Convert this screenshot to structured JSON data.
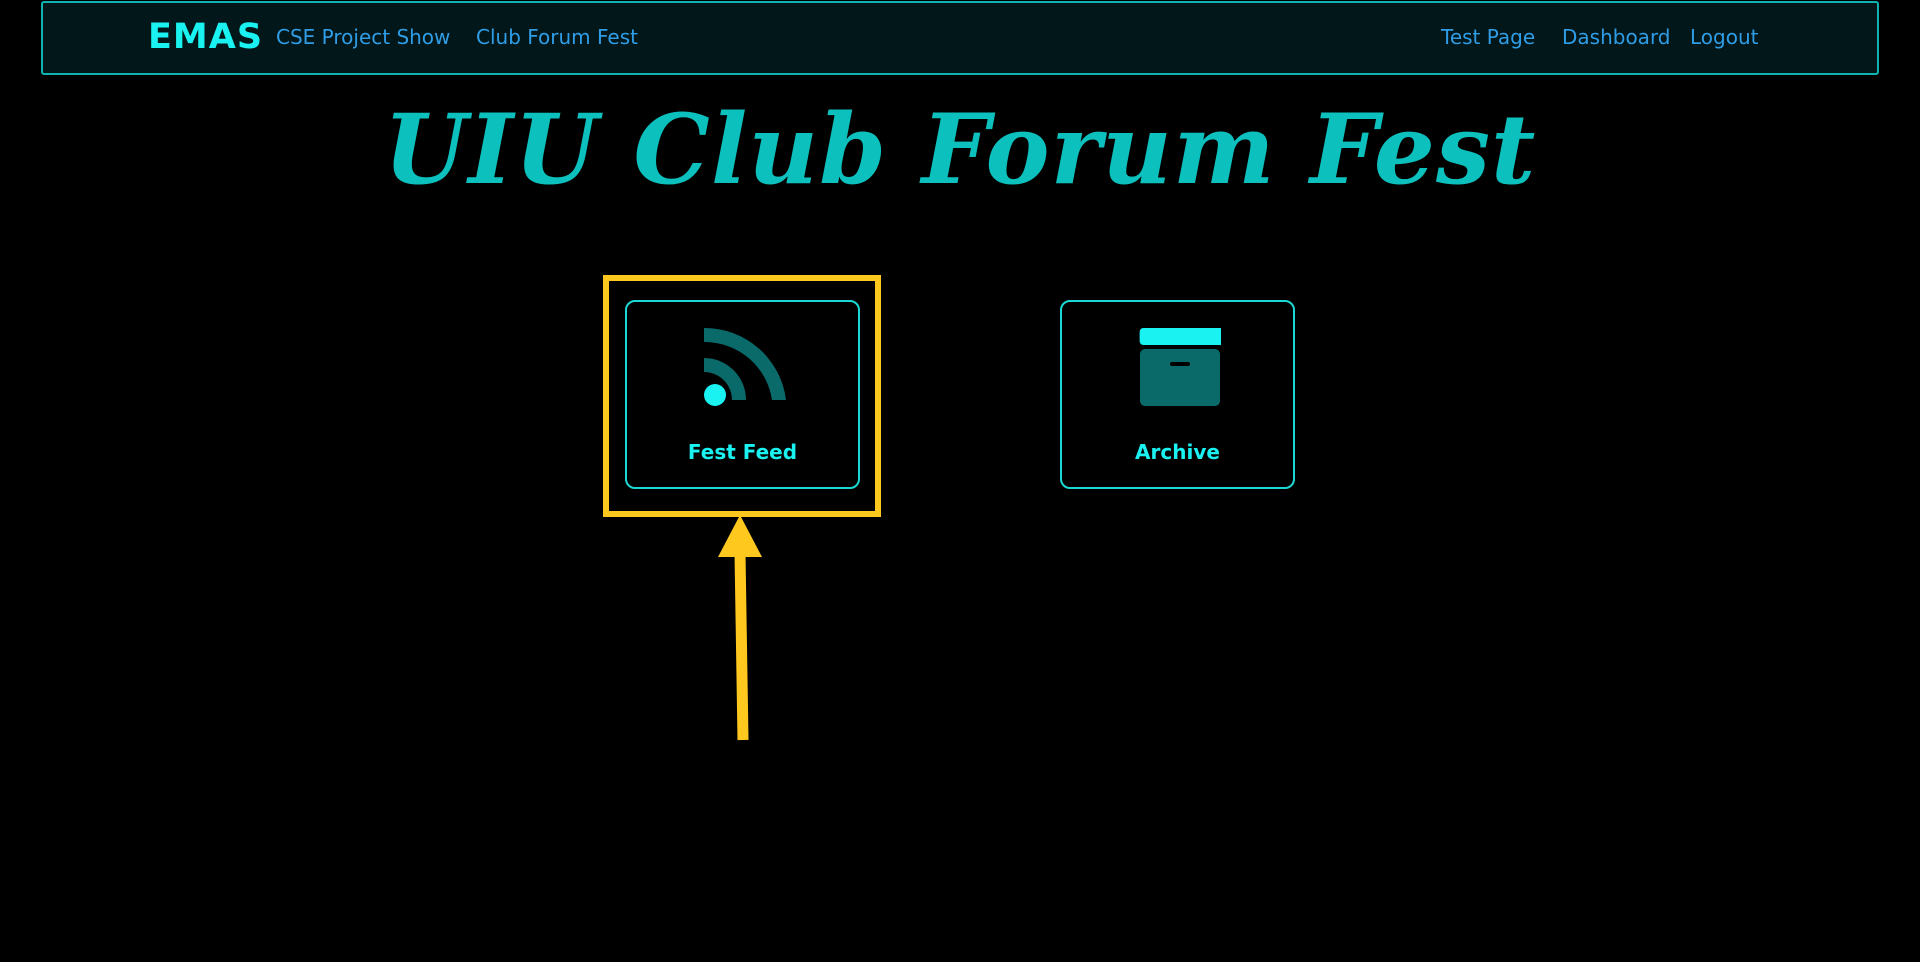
{
  "navbar": {
    "brand": "EMAS",
    "left_links": [
      "CSE Project Show",
      "Club Forum Fest"
    ],
    "right_links": [
      "Test Page",
      "Dashboard",
      "Logout"
    ]
  },
  "page": {
    "title": "UIU Club Forum Fest"
  },
  "cards": [
    {
      "label": "Fest Feed",
      "icon": "rss-feed-icon"
    },
    {
      "label": "Archive",
      "icon": "archive-box-icon"
    }
  ],
  "colors": {
    "background": "#000000",
    "accent": "#19f2f0",
    "title": "#0cc0bd",
    "link": "#2f9de6",
    "highlight": "#ffc81e"
  }
}
